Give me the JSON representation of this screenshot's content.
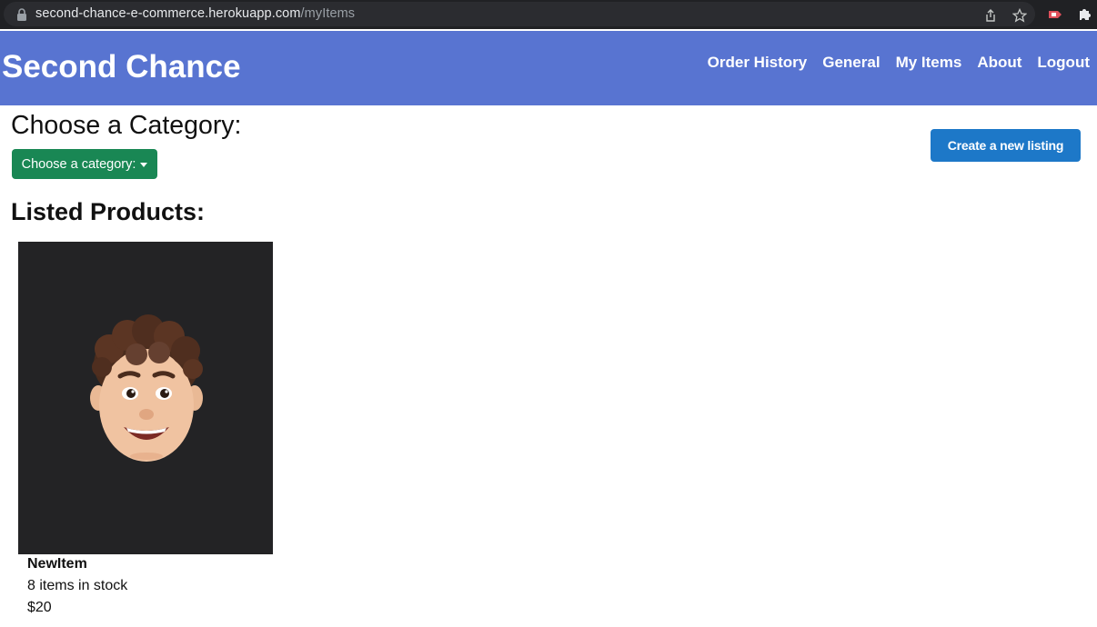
{
  "browser": {
    "url_host": "second-chance-e-commerce.herokuapp.com",
    "url_path": "/myItems",
    "icons": [
      "lock-icon",
      "share-icon",
      "star-icon",
      "extension-red-icon",
      "puzzle-icon"
    ]
  },
  "navbar": {
    "brand": "Second Chance",
    "links": [
      "Order History",
      "General",
      "My Items",
      "About",
      "Logout"
    ],
    "background": "#5874d1"
  },
  "category": {
    "heading": "Choose a Category:",
    "dropdown_label": "Choose a category:",
    "dropdown_color": "#198754"
  },
  "create_listing": {
    "label": "Create a new listing",
    "color": "#1d78c8"
  },
  "products": {
    "heading": "Listed Products:",
    "items": [
      {
        "name": "NewItem",
        "stock": "8 items in stock",
        "price": "$20",
        "image": "memoji-avatar"
      }
    ]
  }
}
